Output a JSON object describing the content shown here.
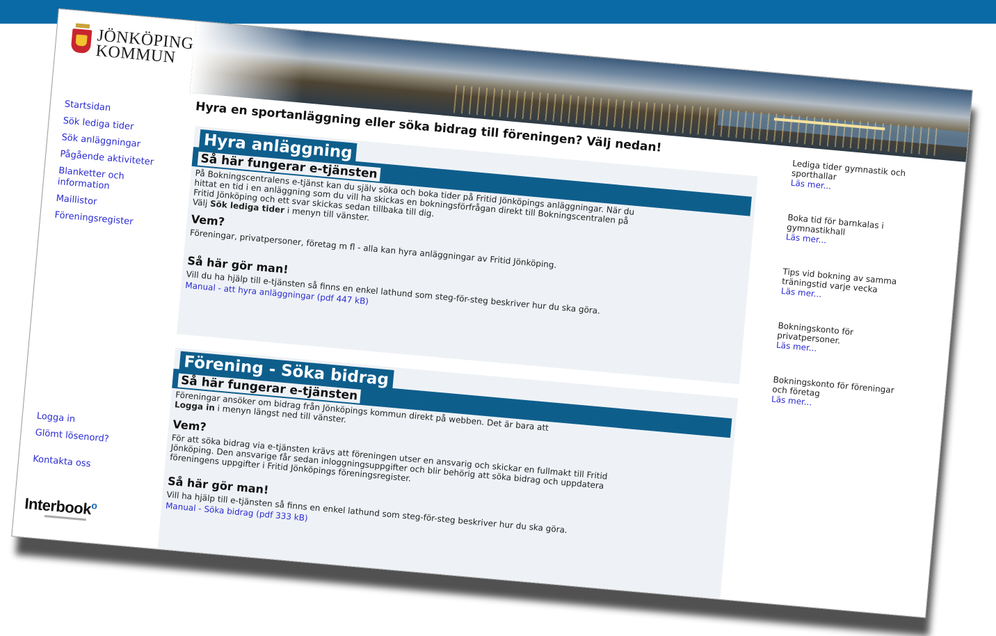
{
  "header": {
    "logo_line1": "JÖNKÖPINGS",
    "logo_line2": "KOMMUN",
    "headline": "Hyra en sportanläggning eller söka bidrag till föreningen? Välj nedan!"
  },
  "nav": {
    "items": [
      {
        "label": "Startsidan"
      },
      {
        "label": "Sök lediga tider"
      },
      {
        "label": "Sök anläggningar"
      },
      {
        "label": "Pågående aktiviteter"
      },
      {
        "label": "Blanketter och information"
      },
      {
        "label": "Maillistor"
      },
      {
        "label": "Föreningsregister"
      }
    ],
    "login": "Logga in",
    "forgot": "Glömt lösenord?",
    "contact": "Kontakta oss",
    "brand": "Interbook"
  },
  "hyra": {
    "title": "Hyra anläggning",
    "subtitle": "Så här fungerar e-tjänsten",
    "intro_1": "På Bokningscentralens e-tjänst kan du själv söka och boka tider på Fritid Jönköpings anläggningar. När du",
    "intro_2": "hittat en tid i en anläggning som du vill ha skickas en bokningsförfrågan direkt till Bokningscentralen på",
    "intro_3": "Fritid Jönköping och ett svar skickas sedan tillbaka till dig.",
    "intro_4_pre": "Välj ",
    "intro_4_bold": "Sök lediga tider",
    "intro_4_post": " i menyn till vänster.",
    "who_title": "Vem?",
    "who_text": "Föreningar, privatpersoner, företag m fl - alla kan hyra anläggningar av Fritid Jönköping.",
    "how_title": "Så här gör man!",
    "how_text": "Vill du ha hjälp till e-tjänsten så finns en enkel lathund som steg-för-steg beskriver hur du ska göra.",
    "manual": "Manual - att hyra anläggningar (pdf 447 kB)"
  },
  "bidrag": {
    "title": "Förening - Söka bidrag",
    "subtitle": "Så här fungerar e-tjänsten",
    "intro_1": "Föreningar ansöker om bidrag från Jönköpings kommun direkt på webben. Det är bara att",
    "intro_2_bold": "Logga in",
    "intro_2_post": " i menyn längst ned till vänster.",
    "who_title": "Vem?",
    "who_1": "För att söka bidrag via e-tjänsten krävs att föreningen utser en ansvarig och skickar en fullmakt till Fritid",
    "who_2": "Jönköping. Den ansvarige får sedan inloggningsuppgifter och blir behörig att söka bidrag och uppdatera",
    "who_3": "föreningens uppgifter i Fritid Jönköpings föreningsregister.",
    "how_title": "Så här gör man!",
    "how_text": "Vill ha hjälp till e-tjänsten så finns en enkel lathund som steg-för-steg beskriver hur du ska göra.",
    "manual": "Manual - Söka bidrag (pdf 333 kB)"
  },
  "right": {
    "items": [
      {
        "l1": "Lediga tider gymnastik och",
        "l2": "sporthallar",
        "more": "Läs mer..."
      },
      {
        "l1": "Boka tid för barnkalas i",
        "l2": "gymnastikhall",
        "more": "Läs mer..."
      },
      {
        "l1": "Tips vid bokning av samma",
        "l2": "träningstid varje vecka",
        "more": "Läs mer..."
      },
      {
        "l1": "Bokningskonto för",
        "l2": "privatpersoner.",
        "more": "Läs mer..."
      },
      {
        "l1": "Bokningskonto för föreningar",
        "l2": "och företag",
        "more": "Läs mer..."
      }
    ]
  },
  "colors": {
    "topband": "#0a6aa5",
    "section_bar": "#0e5e8c",
    "link": "#2b2bd0",
    "section_bg": "#eef2f6"
  }
}
